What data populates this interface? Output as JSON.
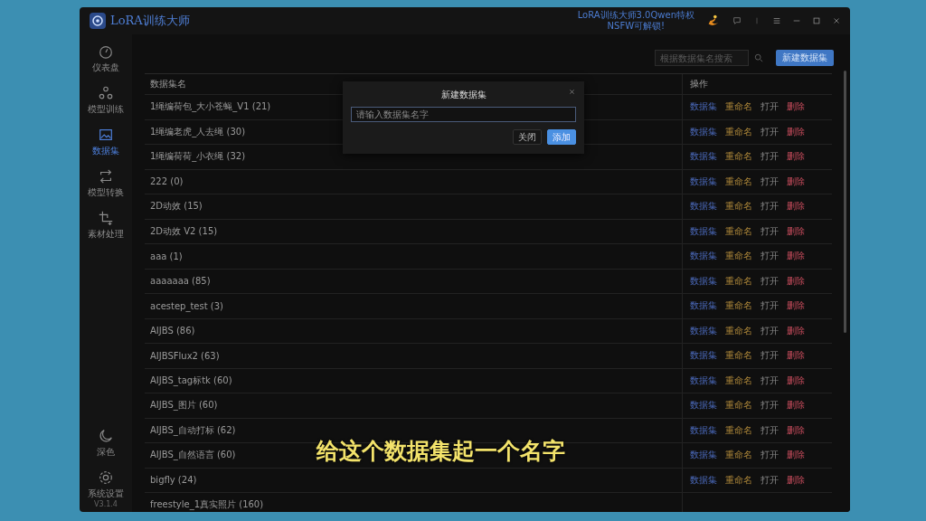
{
  "app": {
    "title": "LoRA训练大师",
    "promo": [
      "LoRA训练大师3.0Qwen特权",
      "NSFW可解锁!"
    ]
  },
  "sidebar": {
    "items": [
      {
        "label": "仪表盘",
        "kind": "gauge",
        "selected": false
      },
      {
        "label": "模型训练",
        "kind": "nodes",
        "selected": false
      },
      {
        "label": "数据集",
        "kind": "image",
        "selected": true
      },
      {
        "label": "模型转换",
        "kind": "swap",
        "selected": false
      },
      {
        "label": "素材处理",
        "kind": "crop",
        "selected": false
      }
    ],
    "bottom": [
      {
        "label": "深色",
        "kind": "moon"
      },
      {
        "label": "系统设置",
        "kind": "gear"
      }
    ],
    "version": "V3.1.4"
  },
  "toolbar": {
    "search_placeholder": "根据数据集名搜索",
    "new_button": "新建数据集"
  },
  "table": {
    "columns": [
      "数据集名",
      "操作"
    ],
    "rows": [
      {
        "name": "1绳编荷包_大小苍蝇_V1 (21)",
        "actions": [
          {
            "label": "数据集",
            "kind": "view"
          },
          {
            "label": "重命名",
            "kind": "rename"
          },
          {
            "label": "打开",
            "kind": "open"
          },
          {
            "label": "删除",
            "kind": "delete"
          }
        ]
      },
      {
        "name": "1绳编老虎_人去绳 (30)",
        "actions": [
          {
            "label": "数据集",
            "kind": "view"
          },
          {
            "label": "重命名",
            "kind": "rename"
          },
          {
            "label": "打开",
            "kind": "open"
          },
          {
            "label": "删除",
            "kind": "delete"
          }
        ]
      },
      {
        "name": "1绳编荷荷_小衣绳 (32)",
        "actions": [
          {
            "label": "数据集",
            "kind": "view"
          },
          {
            "label": "重命名",
            "kind": "rename"
          },
          {
            "label": "打开",
            "kind": "open"
          },
          {
            "label": "删除",
            "kind": "delete"
          }
        ]
      },
      {
        "name": "222 (0)",
        "actions": [
          {
            "label": "数据集",
            "kind": "view"
          },
          {
            "label": "重命名",
            "kind": "rename"
          },
          {
            "label": "打开",
            "kind": "open"
          },
          {
            "label": "删除",
            "kind": "delete"
          }
        ]
      },
      {
        "name": "2D动效 (15)",
        "actions": [
          {
            "label": "数据集",
            "kind": "view"
          },
          {
            "label": "重命名",
            "kind": "rename"
          },
          {
            "label": "打开",
            "kind": "open"
          },
          {
            "label": "删除",
            "kind": "delete"
          }
        ]
      },
      {
        "name": "2D动效 V2 (15)",
        "actions": [
          {
            "label": "数据集",
            "kind": "view"
          },
          {
            "label": "重命名",
            "kind": "rename"
          },
          {
            "label": "打开",
            "kind": "open"
          },
          {
            "label": "删除",
            "kind": "delete"
          }
        ]
      },
      {
        "name": "aaa (1)",
        "actions": [
          {
            "label": "数据集",
            "kind": "view"
          },
          {
            "label": "重命名",
            "kind": "rename"
          },
          {
            "label": "打开",
            "kind": "open"
          },
          {
            "label": "删除",
            "kind": "delete"
          }
        ]
      },
      {
        "name": "aaaaaaa (85)",
        "actions": [
          {
            "label": "数据集",
            "kind": "view"
          },
          {
            "label": "重命名",
            "kind": "rename"
          },
          {
            "label": "打开",
            "kind": "open"
          },
          {
            "label": "删除",
            "kind": "delete"
          }
        ]
      },
      {
        "name": "acestep_test (3)",
        "actions": [
          {
            "label": "数据集",
            "kind": "view"
          },
          {
            "label": "重命名",
            "kind": "rename"
          },
          {
            "label": "打开",
            "kind": "open"
          },
          {
            "label": "删除",
            "kind": "delete"
          }
        ]
      },
      {
        "name": "AIJBS (86)",
        "actions": [
          {
            "label": "数据集",
            "kind": "view"
          },
          {
            "label": "重命名",
            "kind": "rename"
          },
          {
            "label": "打开",
            "kind": "open"
          },
          {
            "label": "删除",
            "kind": "delete"
          }
        ]
      },
      {
        "name": "AIJBSFlux2 (63)",
        "actions": [
          {
            "label": "数据集",
            "kind": "view"
          },
          {
            "label": "重命名",
            "kind": "rename"
          },
          {
            "label": "打开",
            "kind": "open"
          },
          {
            "label": "删除",
            "kind": "delete"
          }
        ]
      },
      {
        "name": "AIJBS_tag标tk (60)",
        "actions": [
          {
            "label": "数据集",
            "kind": "view"
          },
          {
            "label": "重命名",
            "kind": "rename"
          },
          {
            "label": "打开",
            "kind": "open"
          },
          {
            "label": "删除",
            "kind": "delete"
          }
        ]
      },
      {
        "name": "AIJBS_图片 (60)",
        "actions": [
          {
            "label": "数据集",
            "kind": "view"
          },
          {
            "label": "重命名",
            "kind": "rename"
          },
          {
            "label": "打开",
            "kind": "open"
          },
          {
            "label": "删除",
            "kind": "delete"
          }
        ]
      },
      {
        "name": "AIJBS_自动打标 (62)",
        "actions": [
          {
            "label": "数据集",
            "kind": "view"
          },
          {
            "label": "重命名",
            "kind": "rename"
          },
          {
            "label": "打开",
            "kind": "open"
          },
          {
            "label": "删除",
            "kind": "delete"
          }
        ]
      },
      {
        "name": "AIJBS_自然语言 (60)",
        "actions": [
          {
            "label": "数据集",
            "kind": "view"
          },
          {
            "label": "重命名",
            "kind": "rename"
          },
          {
            "label": "打开",
            "kind": "open"
          },
          {
            "label": "删除",
            "kind": "delete"
          }
        ]
      },
      {
        "name": "bigfly (24)",
        "actions": [
          {
            "label": "数据集",
            "kind": "view"
          },
          {
            "label": "重命名",
            "kind": "rename"
          },
          {
            "label": "打开",
            "kind": "open"
          },
          {
            "label": "删除",
            "kind": "delete"
          }
        ]
      },
      {
        "name": "freestyle_1真实照片 (160)",
        "actions": []
      }
    ]
  },
  "dialog": {
    "title": "新建数据集",
    "placeholder": "请输入数据集名字",
    "buttons": [
      {
        "label": "关闭",
        "kind": "secondary"
      },
      {
        "label": "添加",
        "kind": "primary"
      }
    ]
  },
  "subtitle": "给这个数据集起一个名字"
}
